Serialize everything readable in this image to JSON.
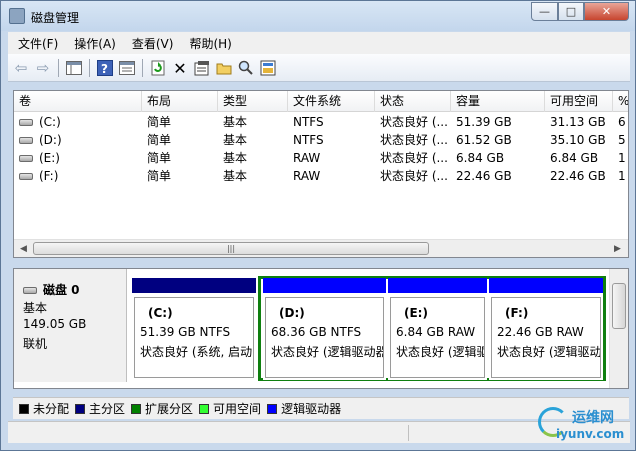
{
  "window": {
    "title": "磁盘管理",
    "controls": {
      "minimize": "—",
      "maximize": "□",
      "close": "✕"
    }
  },
  "menu": [
    "文件(F)",
    "操作(A)",
    "查看(V)",
    "帮助(H)"
  ],
  "toolbar": {
    "icons": [
      "back-icon",
      "forward-icon",
      "show-hide-pane-icon",
      "help-icon",
      "properties-pane-icon",
      "refresh-icon",
      "delete-icon",
      "properties-icon",
      "open-icon",
      "explore-icon",
      "rescan-icon"
    ]
  },
  "volume_table": {
    "columns": [
      "卷",
      "布局",
      "类型",
      "文件系统",
      "状态",
      "容量",
      "可用空间",
      "%"
    ],
    "rows": [
      {
        "volume": "(C:)",
        "layout": "简单",
        "type": "基本",
        "fs": "NTFS",
        "status": "状态良好 (...",
        "capacity": "51.39 GB",
        "free": "31.13 GB",
        "pct": "6"
      },
      {
        "volume": "(D:)",
        "layout": "简单",
        "type": "基本",
        "fs": "NTFS",
        "status": "状态良好 (...",
        "capacity": "61.52 GB",
        "free": "35.10 GB",
        "pct": "5"
      },
      {
        "volume": "(E:)",
        "layout": "简单",
        "type": "基本",
        "fs": "RAW",
        "status": "状态良好 (...",
        "capacity": "6.84 GB",
        "free": "6.84 GB",
        "pct": "1"
      },
      {
        "volume": "(F:)",
        "layout": "简单",
        "type": "基本",
        "fs": "RAW",
        "status": "状态良好 (...",
        "capacity": "22.46 GB",
        "free": "22.46 GB",
        "pct": "1"
      }
    ],
    "scroll_grip": "|||"
  },
  "disk": {
    "name": "磁盘 0",
    "type": "基本",
    "size": "149.05 GB",
    "state": "联机"
  },
  "partitions": [
    {
      "label": "(C:)",
      "size_fs": "51.39 GB NTFS",
      "status": "状态良好 (系统, 启动",
      "kind": "primary"
    },
    {
      "label": "(D:)",
      "size_fs": "68.36 GB NTFS",
      "status": "状态良好 (逻辑驱动器",
      "kind": "logical"
    },
    {
      "label": "(E:)",
      "size_fs": "6.84 GB RAW",
      "status": "状态良好 (逻辑驱",
      "kind": "logical"
    },
    {
      "label": "(F:)",
      "size_fs": "22.46 GB RAW",
      "status": "状态良好 (逻辑驱动",
      "kind": "logical-selected"
    }
  ],
  "legend": [
    {
      "label": "未分配",
      "color": "#000000"
    },
    {
      "label": "主分区",
      "color": "#000080"
    },
    {
      "label": "扩展分区",
      "color": "#008000"
    },
    {
      "label": "可用空间",
      "color": "#33ff33"
    },
    {
      "label": "逻辑驱动器",
      "color": "#0000ff"
    }
  ],
  "colors": {
    "primary_bar": "#000080",
    "logical_bar": "#0000ff",
    "extended_border": "#0f7f0f"
  },
  "watermark": {
    "cn": "运维网",
    "url": "iyunv.com"
  }
}
